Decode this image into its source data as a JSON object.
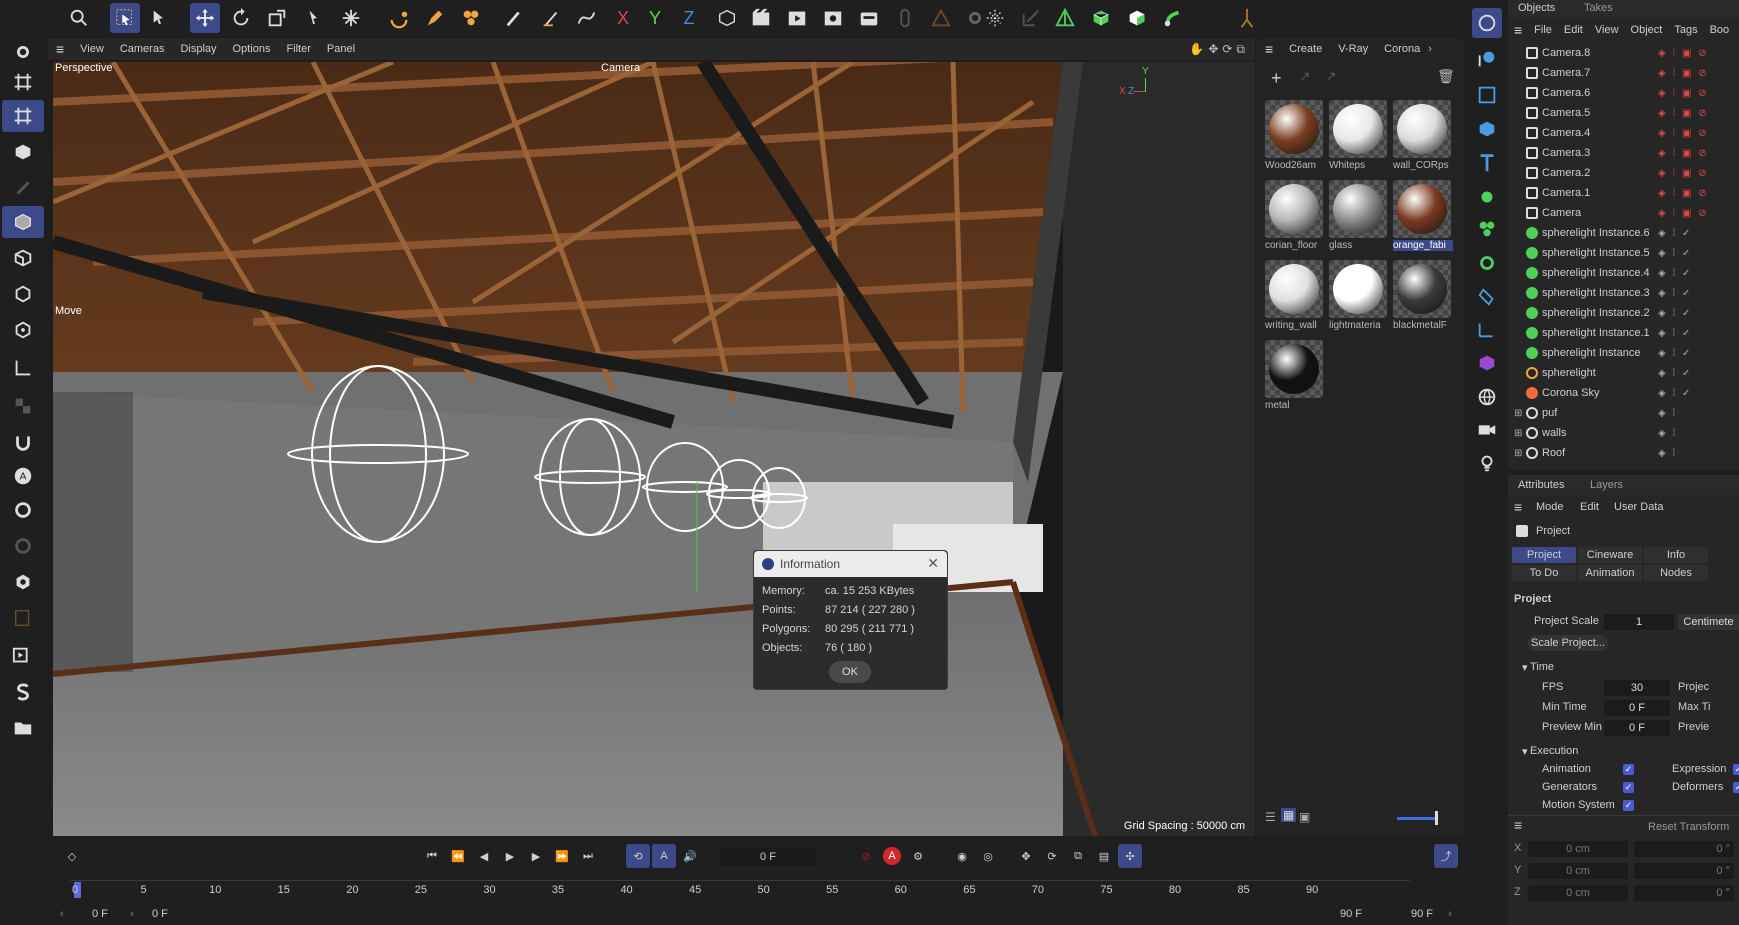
{
  "top_toolbar": {
    "icons": [
      "search-icon",
      "select-icon",
      "magic-select-icon",
      "move-icon",
      "rotate-icon",
      "scale-icon",
      "axis-icon",
      "snap-icon",
      "undo-icon",
      "pen-icon",
      "paint-icon",
      "brush-icon",
      "knife-icon",
      "spline-icon",
      "x-axis-icon",
      "y-axis-icon",
      "z-axis-icon",
      "coordinate-icon",
      "render-region-icon",
      "render-view-icon",
      "render-settings-icon",
      "edit-render-icon",
      "link-icon",
      "triangle-icon",
      "gear-icon",
      "particle-icon",
      "export-icon",
      "pyramid-icon",
      "cube-green-icon",
      "cube-icon",
      "grab-icon",
      "bone-icon"
    ],
    "axis_labels": {
      "x": "X",
      "y": "Y",
      "z": "Z"
    }
  },
  "viewport_menu": [
    "View",
    "Cameras",
    "Display",
    "Options",
    "Filter",
    "Panel"
  ],
  "viewport": {
    "name": "Perspective",
    "camera_label": "Camera",
    "hud_label": "Move",
    "grid_spacing": "Grid Spacing : 50000 cm",
    "axis": {
      "x": "X",
      "y": "Y",
      "z": "Z"
    }
  },
  "info_dialog": {
    "title": "Information",
    "rows": [
      {
        "label": "Memory:",
        "value": "ca. 15 253 KBytes"
      },
      {
        "label": "Points:",
        "value": "87 214 ( 227 280 )"
      },
      {
        "label": "Polygons:",
        "value": "80 295 ( 211 771 )"
      },
      {
        "label": "Objects:",
        "value": "76 ( 180 )"
      }
    ],
    "ok_label": "OK"
  },
  "material_panel": {
    "menu": [
      "Create",
      "V-Ray",
      "Corona"
    ],
    "materials": [
      {
        "name": "Wood26am",
        "color": "#7a3e22"
      },
      {
        "name": "Whiteps",
        "color": "#e8e8e8"
      },
      {
        "name": "wall_CORps",
        "color": "#dcdcdc"
      },
      {
        "name": "corian_floor",
        "color": "#b5b5b5"
      },
      {
        "name": "glass",
        "color": "#8c8c8c"
      },
      {
        "name": "orange_fabi",
        "color": "#7a3a22",
        "selected": true
      },
      {
        "name": "writing_wall",
        "color": "#e0e0e0"
      },
      {
        "name": "lightmateria",
        "color": "#ffffff"
      },
      {
        "name": "blackmetalF",
        "color": "#3a3a3a"
      },
      {
        "name": "metal",
        "color": "#111111"
      }
    ]
  },
  "objects_panel": {
    "tabs": [
      "Objects",
      "Takes"
    ],
    "menu": [
      "File",
      "Edit",
      "View",
      "Object",
      "Tags",
      "Boo"
    ],
    "items": [
      {
        "name": "Camera.8",
        "type": "camera"
      },
      {
        "name": "Camera.7",
        "type": "camera"
      },
      {
        "name": "Camera.6",
        "type": "camera"
      },
      {
        "name": "Camera.5",
        "type": "camera"
      },
      {
        "name": "Camera.4",
        "type": "camera"
      },
      {
        "name": "Camera.3",
        "type": "camera"
      },
      {
        "name": "Camera.2",
        "type": "camera"
      },
      {
        "name": "Camera.1",
        "type": "camera"
      },
      {
        "name": "Camera",
        "type": "camera"
      },
      {
        "name": "spherelight Instance.6",
        "type": "instance"
      },
      {
        "name": "spherelight Instance.5",
        "type": "instance"
      },
      {
        "name": "spherelight Instance.4",
        "type": "instance"
      },
      {
        "name": "spherelight Instance.3",
        "type": "instance"
      },
      {
        "name": "spherelight Instance.2",
        "type": "instance"
      },
      {
        "name": "spherelight Instance.1",
        "type": "instance"
      },
      {
        "name": "spherelight Instance",
        "type": "instance"
      },
      {
        "name": "spherelight",
        "type": "light"
      },
      {
        "name": "Corona Sky",
        "type": "sky"
      },
      {
        "name": "puf",
        "type": "null"
      },
      {
        "name": "walls",
        "type": "null"
      },
      {
        "name": "Roof",
        "type": "null"
      }
    ]
  },
  "attributes_panel": {
    "tabs": [
      "Attributes",
      "Layers"
    ],
    "menu": [
      "Mode",
      "Edit",
      "User Data"
    ],
    "object_label": "Project",
    "subtabs": [
      "Project",
      "Cineware",
      "Info"
    ],
    "subtabs2": [
      "To Do",
      "Animation",
      "Nodes"
    ],
    "section": "Project",
    "project_scale_label": "Project Scale",
    "project_scale_value": "1",
    "project_scale_unit": "Centimete",
    "scale_button": "Scale Project...",
    "time_group": "Time",
    "fps_label": "FPS",
    "fps_value": "30",
    "project_label": "Projec",
    "min_time_label": "Min Time",
    "min_time_value": "0 F",
    "max_time_label": "Max Ti",
    "preview_min_label": "Preview Min",
    "preview_min_value": "0 F",
    "preview_label": "Previe",
    "execution_group": "Execution",
    "animation": "Animation",
    "expression": "Expression",
    "generators": "Generators",
    "deformers": "Deformers",
    "motion_system": "Motion System",
    "reset_transform": "Reset Transform",
    "coord_labels": [
      "X",
      "Y",
      "Z"
    ],
    "coord_values": [
      "0 cm",
      "0 cm",
      "0 cm"
    ],
    "rot_values": [
      "0 °",
      "0 °",
      "0 °"
    ]
  },
  "timeline": {
    "current_frame": "0 F",
    "ticks": [
      "0",
      "5",
      "10",
      "15",
      "20",
      "25",
      "30",
      "35",
      "40",
      "45",
      "50",
      "55",
      "60",
      "65",
      "70",
      "75",
      "80",
      "85",
      "90"
    ],
    "start_field": "0 F",
    "start_field2": "0 F",
    "end_field": "90 F",
    "end_field2": "90 F"
  }
}
